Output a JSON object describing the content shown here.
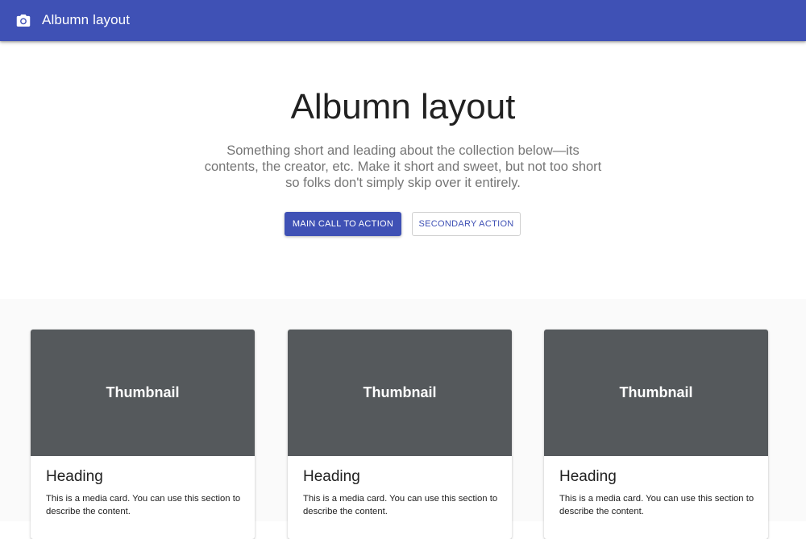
{
  "appbar": {
    "icon": "camera-icon",
    "title": "Albumn layout",
    "color": "#3f51b5"
  },
  "hero": {
    "title": "Albumn layout",
    "description": "Something short and leading about the collection below—its contents, the creator, etc. Make it short and sweet, but not too short so folks don't simply skip over it entirely.",
    "primary_button_label": "MAIN CALL TO ACTION",
    "secondary_button_label": "SECONDARY ACTION"
  },
  "cards": [
    {
      "media_label": "Thumbnail",
      "heading": "Heading",
      "text": "This is a media card. You can use this section to describe the content."
    },
    {
      "media_label": "Thumbnail",
      "heading": "Heading",
      "text": "This is a media card. You can use this section to describe the content."
    },
    {
      "media_label": "Thumbnail",
      "heading": "Heading",
      "text": "This is a media card. You can use this section to describe the content."
    }
  ],
  "colors": {
    "primary": "#3f51b5",
    "thumbnail_bg": "#55595c",
    "album_bg": "#fafafa"
  }
}
